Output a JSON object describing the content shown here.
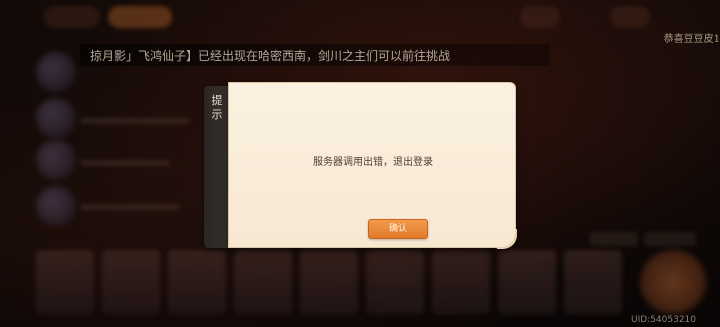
{
  "announcement": {
    "text": "掠月影」飞鸿仙子】已经出现在哈密西南，剑川之主们可以前往挑战"
  },
  "corner_notice": "恭喜豆豆皮1",
  "dialog": {
    "title": "提示",
    "message": "服务器调用出错，退出登录",
    "confirm_label": "确认"
  },
  "footer": {
    "uid": "UID:54053210"
  },
  "colors": {
    "accent": "#e8873a",
    "dialog_bg": "#fbf1e1",
    "spine": "#2f2925"
  }
}
